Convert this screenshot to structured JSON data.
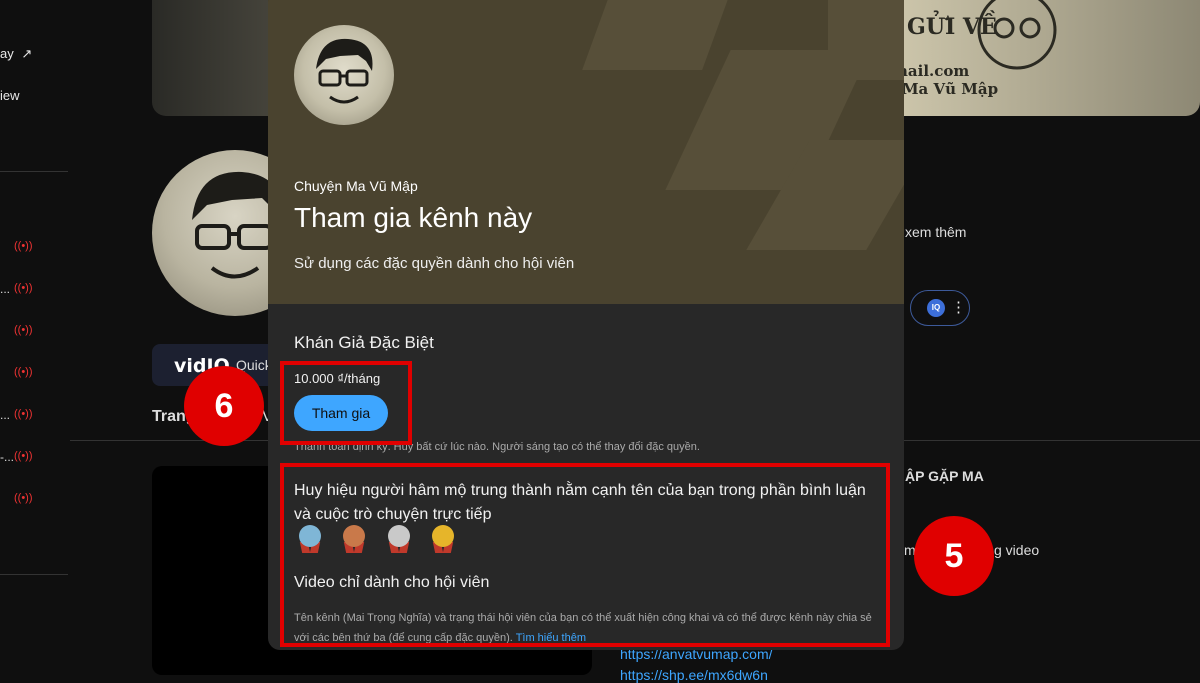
{
  "sidebar": {
    "top_items": [
      "ay",
      "iew"
    ],
    "live_items_count": 7,
    "truncated_suffixes": [
      "...",
      "...",
      "-..."
    ]
  },
  "banner": {
    "line1": "GỬI VỀ",
    "line2": "nail.com",
    "line3": "a Ma Vũ Mập"
  },
  "background": {
    "see_more": "xem thêm",
    "vidiq_logo": "vidIQ",
    "vidiq_text": "Quick",
    "tab_home": "Trang",
    "tab_partial": "V",
    "playlist_title": "ẬP GẶP MA",
    "video_text_1": "m",
    "video_text_2": "g video",
    "iq_label": "IQ",
    "links": [
      "https://anvatvumap.com/",
      "https://shp.ee/mx6dw6n"
    ]
  },
  "modal": {
    "channel_name": "Chuyện Ma Vũ Mập",
    "title": "Tham gia kênh này",
    "subtitle": "Sử dụng các đặc quyền dành cho hội viên",
    "tier_name": "Khán Giả Đặc Biệt",
    "price": "10.000 ₫/tháng",
    "join_label": "Tham gia",
    "terms": "Thanh toán định kỳ. Hủy bất cứ lúc nào. Người sáng tạo có thể thay đổi đặc quyền.",
    "perk_badges": "Huy hiệu người hâm mộ trung thành nằm cạnh tên của bạn trong phần bình luận và cuộc trò chuyện trực tiếp",
    "badge_colors": [
      "#7fb6d6",
      "#c9794a",
      "#c9c9c9",
      "#e6b52a"
    ],
    "perk_videos": "Video chỉ dành cho hội viên",
    "privacy": "Tên kênh (Mai Trọng Nghĩa) và trạng thái hội viên của bạn có thể xuất hiện công khai và có thể được kênh này chia sẻ với các bên thứ ba (để cung cấp đặc quyền).",
    "learn_more": "Tìm hiểu thêm"
  },
  "annotations": {
    "step_join": "6",
    "step_perks": "5",
    "highlight_color": "#e00000"
  }
}
